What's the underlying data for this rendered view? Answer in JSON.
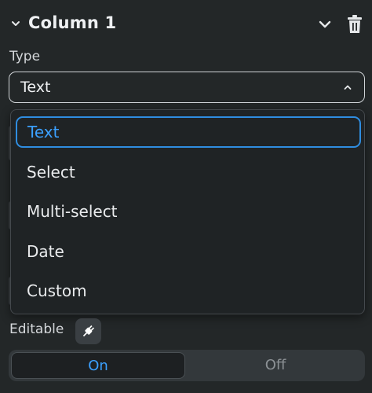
{
  "header": {
    "title": "Column 1",
    "icons": [
      "chevron-down-icon",
      "collapse-chevron-icon",
      "trash-icon"
    ]
  },
  "type_field": {
    "label": "Type",
    "selected_value": "Text",
    "options": [
      {
        "label": "Text",
        "selected": true
      },
      {
        "label": "Select",
        "selected": false
      },
      {
        "label": "Multi-select",
        "selected": false
      },
      {
        "label": "Date",
        "selected": false
      },
      {
        "label": "Custom",
        "selected": false
      }
    ]
  },
  "editable": {
    "label": "Editable",
    "icon": "plug-icon",
    "on_label": "On",
    "off_label": "Off",
    "active": "On"
  },
  "colors": {
    "background": "#232728",
    "accent": "#3ba0ff",
    "selected_border": "#2f8de0"
  }
}
